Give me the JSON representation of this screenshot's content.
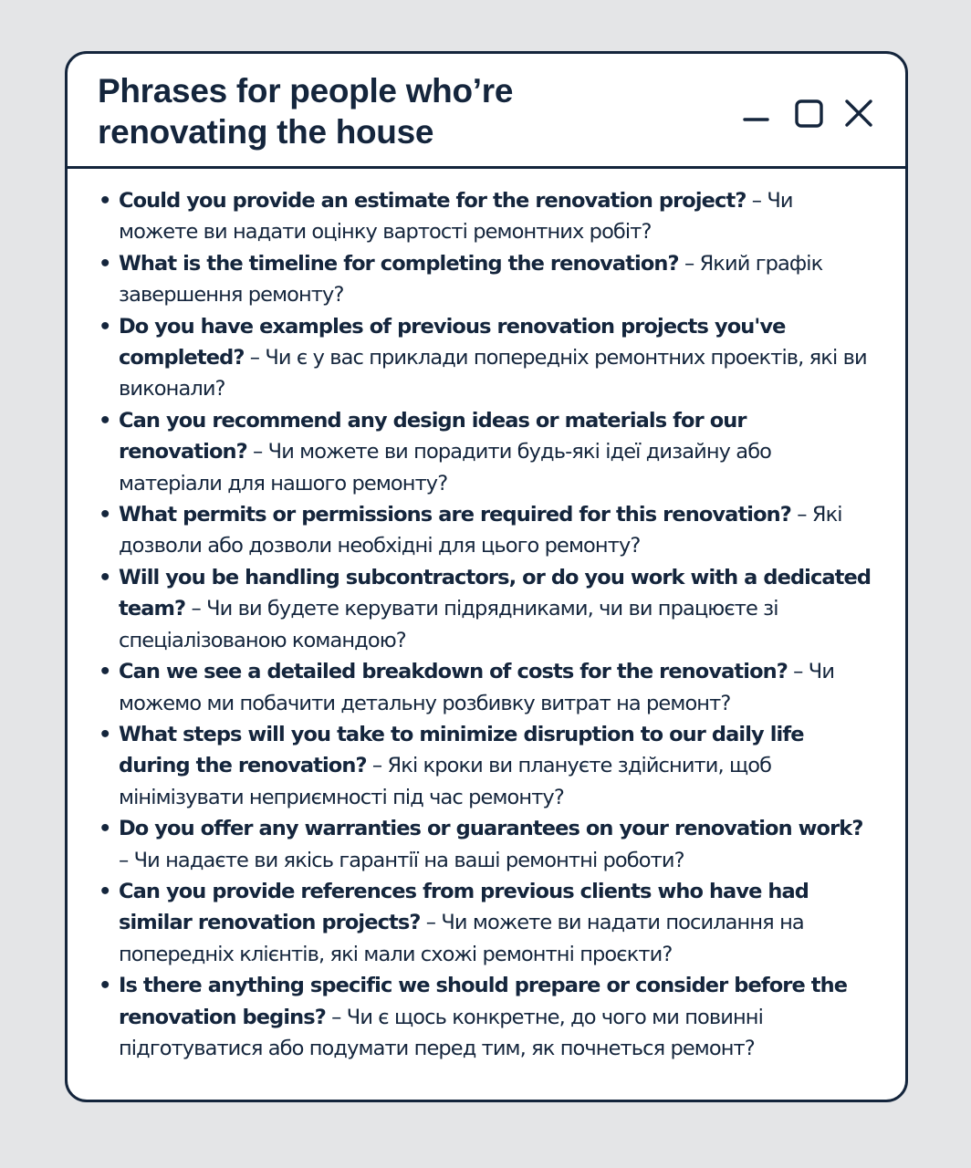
{
  "window": {
    "title_line1": "Phrases for people who’re",
    "title_line2": "renovating the house",
    "controls": {
      "minimize_icon": "minimize-icon",
      "maximize_icon": "maximize-icon",
      "close_icon": "close-icon"
    }
  },
  "bullet": "•",
  "separator": "–",
  "items": [
    {
      "en": "Could you provide an estimate for the renovation project?",
      "uk": "Чи можете ви надати оцінку вартості ремонтних робіт?"
    },
    {
      "en": "What is the timeline for completing the renovation?",
      "uk": "Який графік завершення ремонту?"
    },
    {
      "en": "Do you have examples of previous renovation projects you've completed?",
      "uk": "Чи є у вас приклади попередніх ремонтних проектів, які ви виконали?"
    },
    {
      "en": "Can you recommend any design ideas or materials for our renovation?",
      "uk": "Чи можете ви порадити будь-які ідеї дизайну або матеріали для нашого ремонту?"
    },
    {
      "en": "What permits or permissions are required for this renovation?",
      "uk": "Які дозволи або дозволи необхідні для цього ремонту?"
    },
    {
      "en": "Will you be handling subcontractors, or do you work with a dedicated team?",
      "uk": "Чи ви будете керувати підрядниками, чи ви працюєте зі спеціалізованою командою?"
    },
    {
      "en": "Can we see a detailed breakdown of costs for the renovation?",
      "uk": "Чи можемо ми побачити детальну розбивку витрат на ремонт?"
    },
    {
      "en": "What steps will you take to minimize disruption to our daily life during the renovation?",
      "uk": "Які кроки ви плануєте здійснити, щоб мінімізувати неприємності під час ремонту?"
    },
    {
      "en": "Do you offer any warranties or guarantees on your renovation work?",
      "uk": "Чи надаєте ви якісь гарантії на ваші ремонтні роботи?"
    },
    {
      "en": "Can you provide references from previous clients who have had similar renovation projects?",
      "uk": "Чи можете ви надати посилання на попередніх клієнтів, які мали схожі ремонтні проєкти?"
    },
    {
      "en": "Is there anything specific we should prepare or consider before the renovation begins?",
      "uk": "Чи є щось конкретне, до чого ми повинні підготуватися або подумати перед тим, як почнеться ремонт?"
    }
  ],
  "colors": {
    "background": "#e4e5e7",
    "window": "#ffffff",
    "ink": "#14253c"
  }
}
